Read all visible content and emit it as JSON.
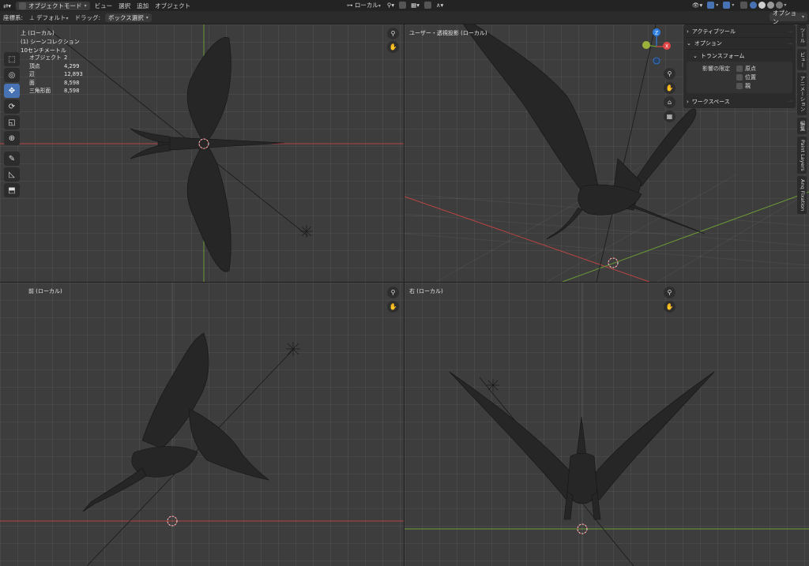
{
  "header": {
    "mode": "オブジェクトモード",
    "menus": [
      "ビュー",
      "選択",
      "追加",
      "オブジェクト"
    ],
    "transform_orientation": "ローカル"
  },
  "toolbar": {
    "orientation_label": "座標系:",
    "orientation_value": "デフォルト",
    "drag_label": "ドラッグ:",
    "drag_value": "ボックス選択",
    "options_label": "オプション"
  },
  "viewports": {
    "top": {
      "title": "上 (ローカル)",
      "collection": "(1) シーンコレクション",
      "scale": "10センチメートル"
    },
    "user": {
      "title": "ユーザー・透視投影 (ローカル)"
    },
    "front": {
      "title": "前 (ローカル)"
    },
    "right": {
      "title": "右 (ローカル)"
    }
  },
  "stats": {
    "objects_label": "オブジェクト",
    "objects_value": "2",
    "verts_label": "頂点",
    "verts_value": "4,299",
    "edges_label": "辺",
    "edges_value": "12,893",
    "faces_label": "面",
    "faces_value": "8,598",
    "tris_label": "三角形面",
    "tris_value": "8,598"
  },
  "npanel": {
    "active_tool": "アクティブツール",
    "options": "オプション",
    "transform": "トランスフォーム",
    "affect_only": "影響の限定",
    "origins": "原点",
    "locations": "位置",
    "parents": "親",
    "workspace": "ワークスペース"
  },
  "sidetabs": [
    "ツール",
    "ビュー",
    "アニメーション",
    "編集",
    "Paint Layers",
    "Anq Fixation"
  ],
  "gizmo": {
    "z": "Z",
    "x": "X"
  },
  "icons": {
    "zoom": "magnifier-icon",
    "pan": "hand-icon",
    "camera": "camera-icon",
    "grid": "grid-icon"
  },
  "colors": {
    "axis_x": "#c74a4a",
    "axis_y": "#6c9a36",
    "gizmo_z": "#2f7fe0",
    "gizmo_x": "#e04545",
    "active_tool": "#4772b3"
  }
}
